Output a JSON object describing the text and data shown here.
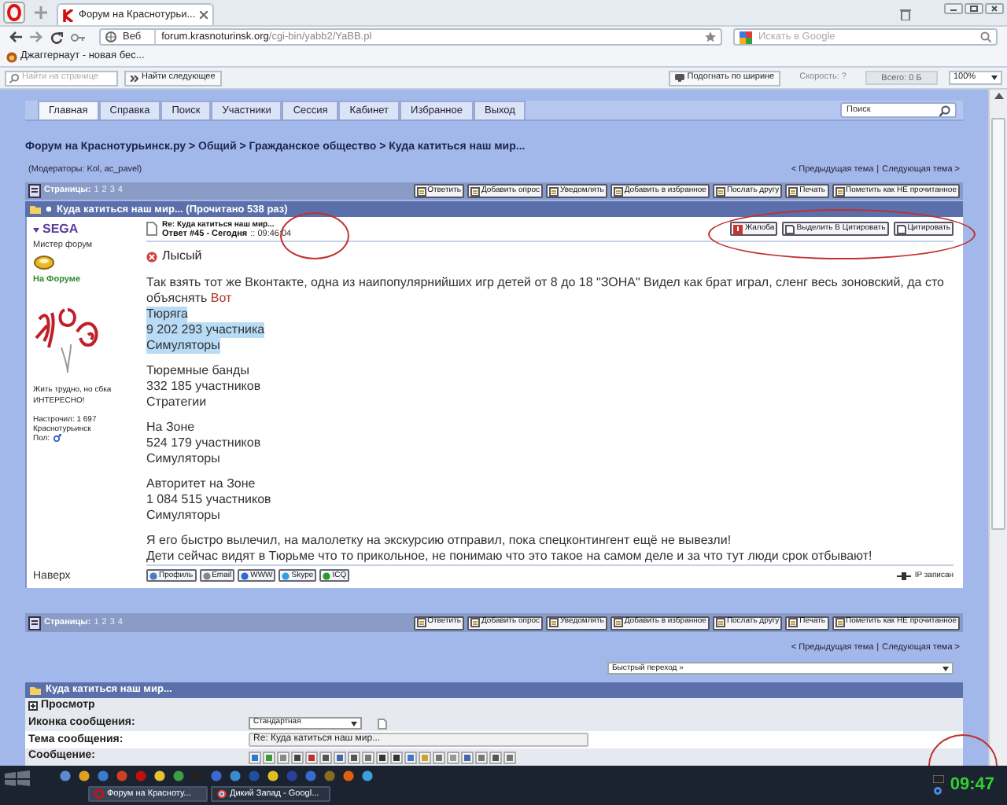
{
  "browser": {
    "tab": {
      "title": "Форум на Краснотурьи...",
      "selected": true
    },
    "address": {
      "badge": "Веб",
      "host": "forum.krasnoturinsk.org",
      "path": "/cgi-bin/yabb2/YaBB.pl"
    },
    "search": {
      "placeholder": "Искать в Google"
    },
    "bookmarks": [
      "Джаггернаут - новая бес..."
    ],
    "find_bar": {
      "placeholder": "Найти на странице",
      "next_button": "Найти следующее",
      "fit_button": "Подогнать по ширине",
      "speed": "Скорость: ?",
      "total": "Всего: 0 Б",
      "zoom": "100%"
    }
  },
  "forum": {
    "nav": [
      {
        "label": "Главная",
        "selected": true
      },
      {
        "label": "Справка",
        "selected": false
      },
      {
        "label": "Поиск",
        "selected": false
      },
      {
        "label": "Участники",
        "selected": false
      },
      {
        "label": "Сессия",
        "selected": false
      },
      {
        "label": "Кабинет",
        "selected": false
      },
      {
        "label": "Избранное",
        "selected": false
      },
      {
        "label": "Выход",
        "selected": false
      }
    ],
    "search": {
      "placeholder": "Поиск"
    },
    "breadcrumb": "Форум на Краснотурьинск.ру > Общий > Гражданское общество > Куда катиться наш мир...",
    "moderators": "(Модераторы: Kol, ac_pavel)",
    "prev_next_top": {
      "prev": "< Предыдущая тема",
      "separator": "|",
      "next": "Следующая тема >"
    },
    "toolbar_top": {
      "pages_label": "Страницы:",
      "pages": [
        "1",
        "2",
        "3",
        "4"
      ],
      "actions": [
        "Ответить",
        "Добавить опрос",
        "Уведомлять",
        "Добавить в избранное",
        "Послать другу",
        "Печать",
        "Пометить как НЕ прочитанное"
      ]
    },
    "thread_header": "Куда катиться наш мир... (Прочитано 538 раз)",
    "post": {
      "author": {
        "name": "SEGA",
        "rank": "Мистер форум",
        "status": "На Форуме",
        "signature": "Жить трудно, но сбка ИНТЕРЕСНО!",
        "posts": "Настрочил: 1 697",
        "city": "Краснотурьинск",
        "gender": "Пол:"
      },
      "subject": "Re: Куда катиться наш мир...",
      "reply_info": "Ответ #45 - Сегодня",
      "time": ":: 09:46:04",
      "buttons": [
        "Жалоба",
        "Выделить В Цитировать",
        "Цитировать"
      ],
      "title": "Лысый",
      "intro": {
        "text": "Так взять тот же Вконтакте, одна из наипопулярнийших игр детей от 8 до 18 \"ЗОНА\" Видел как брат играл, сленг весь зоновский, да сто объяснять",
        "link": "Вот"
      },
      "paragraphs": [
        [
          {
            "text": "Тюряга",
            "highlighted": true
          },
          {
            "text": "9 202 293 участника",
            "highlighted": true
          },
          {
            "text": "Симуляторы",
            "highlighted": true
          }
        ],
        [
          {
            "text": "Тюремные банды",
            "highlighted": false
          },
          {
            "text": "332 185 участников",
            "highlighted": false
          },
          {
            "text": "Стратегии",
            "highlighted": false
          }
        ],
        [
          {
            "text": "На Зоне",
            "highlighted": false
          },
          {
            "text": "524 179 участников",
            "highlighted": false
          },
          {
            "text": "Симуляторы",
            "highlighted": false
          }
        ],
        [
          {
            "text": "Авторитет на Зоне",
            "highlighted": false
          },
          {
            "text": "1 084 515 участников",
            "highlighted": false
          },
          {
            "text": "Симуляторы",
            "highlighted": false
          }
        ],
        [
          {
            "text": "Я его быстро вылечил, на малолетку на экскурсию отправил, пока спецконтингент ещё не вывезли!",
            "highlighted": false
          },
          {
            "text": "Дети сейчас видят в Тюрьме что то прикольное, не понимаю что это такое на самом деле и за что тут люди срок отбывают!",
            "highlighted": false
          }
        ]
      ],
      "top_link": "Наверх",
      "contacts": [
        "Профиль",
        "Email",
        "WWW",
        "Skype",
        "ICQ"
      ],
      "ip": "IP записан"
    },
    "toolbar_bottom": {
      "pages_label": "Страницы:",
      "pages": [
        "1",
        "2",
        "3",
        "4"
      ],
      "actions": [
        "Ответить",
        "Добавить опрос",
        "Уведомлять",
        "Добавить в избранное",
        "Послать другу",
        "Печать",
        "Пометить как НЕ прочитанное"
      ]
    },
    "prev_next_bottom": {
      "prev": "< Предыдущая тема",
      "separator": "|",
      "next": "Следующая тема >"
    },
    "quick_jump": "Быстрый переход »",
    "reply": {
      "header": "Куда катиться наш мир...",
      "preview": {
        "label": "Просмотр",
        "expanded": false
      },
      "fields": [
        {
          "label": "Иконка сообщения:",
          "kind": "select",
          "value": "Стандартная"
        },
        {
          "label": "Тема сообщения:",
          "kind": "input",
          "value": "Re: Куда катиться наш мир..."
        },
        {
          "label": "Сообщение:",
          "kind": "toolbar"
        }
      ]
    }
  },
  "taskbar": {
    "tasks": [
      {
        "label": "Форум на Красноту...",
        "selected": true
      },
      {
        "label": "Дикий Запад - Googl...",
        "selected": false
      }
    ],
    "clock": "09:47"
  }
}
